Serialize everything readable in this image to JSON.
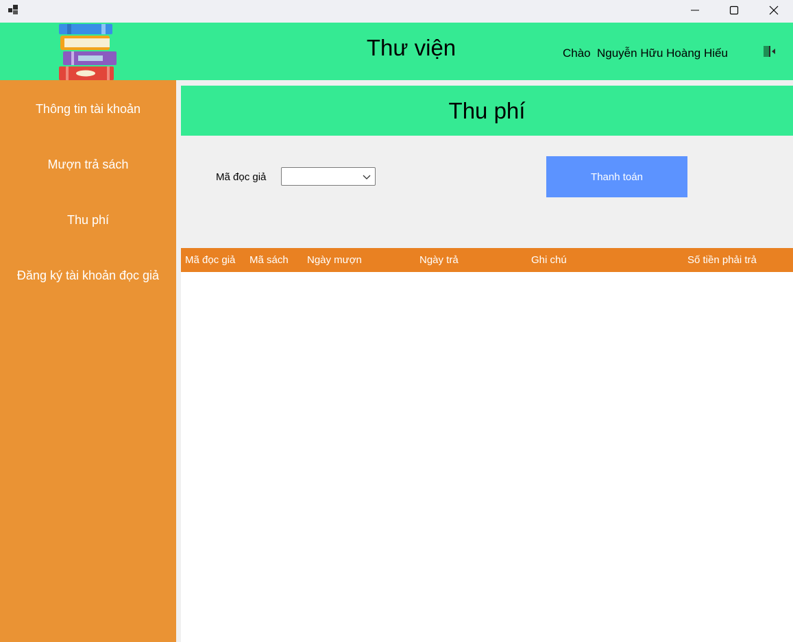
{
  "window": {
    "icon": "app-window-icon",
    "controls": [
      "minimize-icon",
      "maximize-icon",
      "close-icon"
    ]
  },
  "header": {
    "title": "Thư viện",
    "greeting": "Chào",
    "user_name": "Nguyễn Hữu Hoàng Hiếu",
    "logo_icon": "book-stack-icon",
    "logout_icon": "logout-icon"
  },
  "sidebar": {
    "items": [
      {
        "label": "Thông tin tài khoản"
      },
      {
        "label": "Mượn trả sách"
      },
      {
        "label": "Thu phí"
      },
      {
        "label": "Đăng ký tài khoản đọc giả"
      }
    ]
  },
  "main": {
    "section_title": "Thu phí",
    "reader_label": "Mã đọc giả",
    "reader_select_value": "",
    "pay_button": "Thanh toán",
    "table": {
      "columns": [
        "Mã đọc giả",
        "Mã sách",
        "Ngày mượn",
        "Ngày trả",
        "Ghi chú",
        "Số tiền phải trả"
      ],
      "rows": []
    }
  },
  "colors": {
    "header_green": "#35ea93",
    "sidebar_orange": "#ea9334",
    "table_header_orange": "#e98122",
    "button_blue": "#5c93ff",
    "panel_gray": "#f0f0f0"
  }
}
